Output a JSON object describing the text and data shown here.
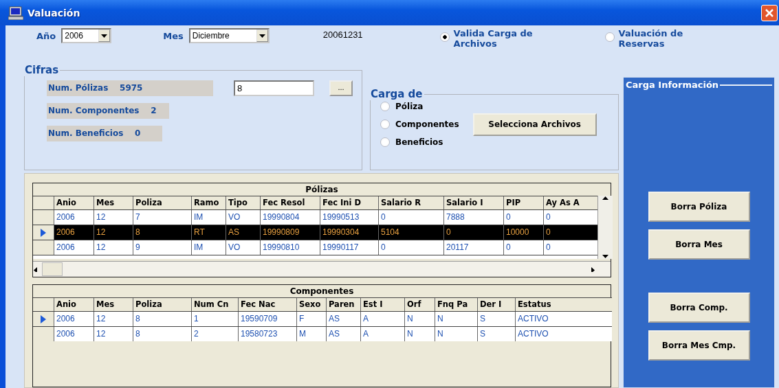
{
  "window": {
    "title": "Valuación"
  },
  "filters": [
    {
      "label": "Año",
      "value": "2006"
    },
    {
      "label": "Mes",
      "value": "Diciembre"
    }
  ],
  "period": "20061231",
  "modes": [
    {
      "label": "Valida Carga de Archivos",
      "selected": true
    },
    {
      "label": "Valuación de Reservas",
      "selected": false
    }
  ],
  "cifras": {
    "title": "Cifras",
    "counts": [
      {
        "label": "Num. Pólizas",
        "value": "5975"
      },
      {
        "label": "Num. Componentes",
        "value": "2"
      },
      {
        "label": "Num. Beneficios",
        "value": "0"
      }
    ],
    "input_value": "8",
    "browse_button": "..."
  },
  "carga_de": {
    "title": "Carga de",
    "options": [
      {
        "label": "Póliza",
        "selected": false
      },
      {
        "label": "Componentes",
        "selected": false
      },
      {
        "label": "Beneficios",
        "selected": false
      }
    ],
    "button": "Selecciona Archivos"
  },
  "carga_informacion": {
    "title": "Carga Información",
    "buttons": [
      "Borra Póliza",
      "Borra Mes",
      "Borra Comp.",
      "Borra Mes Cmp."
    ]
  },
  "polizas": {
    "title": "Pólizas",
    "columns": [
      "Anio",
      "Mes",
      "Poliza",
      "Ramo",
      "Tipo",
      "Fec Resol",
      "Fec Ini D",
      "Salario R",
      "Salario I",
      "PIP",
      "Ay As A"
    ],
    "rows": [
      {
        "cells": [
          "2006",
          "12",
          "7",
          "IM",
          "VO",
          "19990804",
          "19990513",
          "0",
          "7888",
          "0",
          "0"
        ],
        "selected": false,
        "current": false
      },
      {
        "cells": [
          "2006",
          "12",
          "8",
          "RT",
          "AS",
          "19990809",
          "19990304",
          "5104",
          "0",
          "10000",
          "0"
        ],
        "selected": true,
        "current": true
      },
      {
        "cells": [
          "2006",
          "12",
          "9",
          "IM",
          "VO",
          "19990810",
          "19990117",
          "0",
          "20117",
          "0",
          "0"
        ],
        "selected": false,
        "current": false
      }
    ]
  },
  "componentes": {
    "title": "Componentes",
    "columns": [
      "Anio",
      "Mes",
      "Poliza",
      "Num Cn",
      "Fec Nac",
      "Sexo",
      "Paren",
      "Est I",
      "Orf",
      "Fnq Pa",
      "Der I",
      "Estatus"
    ],
    "rows": [
      {
        "cells": [
          "2006",
          "12",
          "8",
          "1",
          "19590709",
          "F",
          "AS",
          "A",
          "N",
          "N",
          "S",
          "ACTIVO"
        ],
        "selected": false,
        "current": true
      },
      {
        "cells": [
          "2006",
          "12",
          "8",
          "2",
          "19580723",
          "M",
          "AS",
          "A",
          "N",
          "N",
          "S",
          "ACTIVO"
        ],
        "selected": false,
        "current": false
      }
    ]
  }
}
